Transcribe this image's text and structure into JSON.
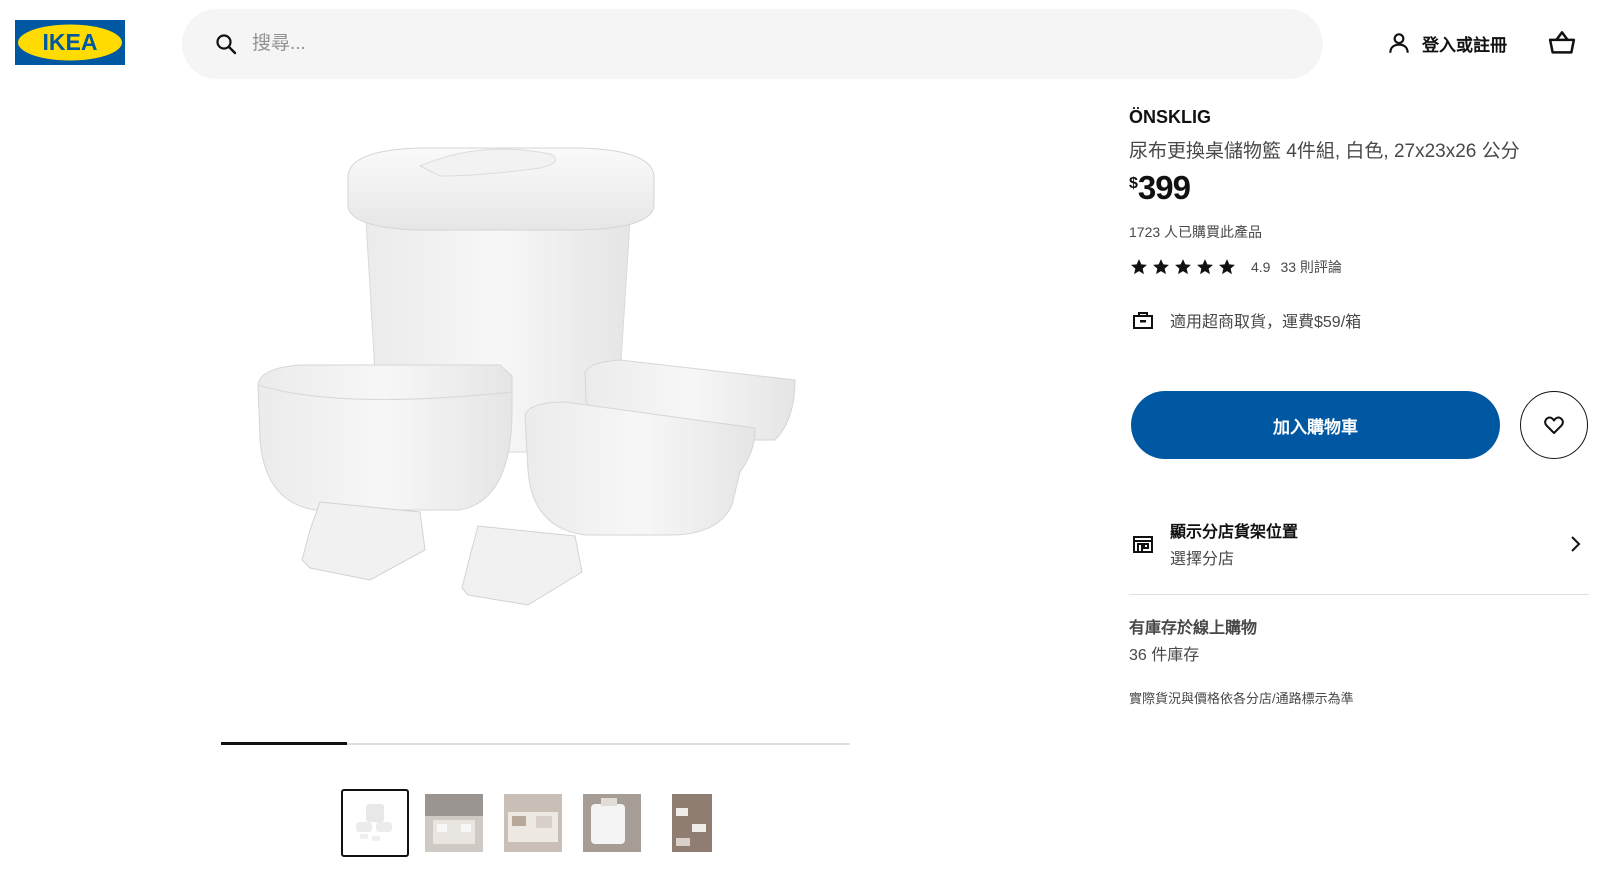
{
  "header": {
    "logo_text": "IKEA",
    "search_placeholder": "搜尋...",
    "login_label": "登入或註冊"
  },
  "gallery": {
    "progress": 0.2,
    "thumbnails": [
      "product-white",
      "room-scene-1",
      "room-scene-2",
      "room-scene-3",
      "room-scene-4"
    ],
    "active_thumbnail": 0
  },
  "product": {
    "name": "ÖNSKLIG",
    "description": "尿布更換桌儲物籃 4件組, 白色, 27x23x26 公分",
    "currency": "$",
    "price": "399",
    "bought": "1723 人已購買此產品",
    "rating_stars": 5,
    "rating_score": "4.9",
    "reviews": "33 則評論",
    "delivery": "適用超商取貨，運費$59/箱"
  },
  "actions": {
    "add_to_cart": "加入購物車"
  },
  "store": {
    "title": "顯示分店貨架位置",
    "subtitle": "選擇分店"
  },
  "stock": {
    "title": "有庫存於線上購物",
    "count": "36 件庫存",
    "disclaimer": "實際貨況與價格依各分店/通路標示為準"
  },
  "colors": {
    "ikea_blue": "#0058a3",
    "ikea_yellow": "#ffdb00",
    "search_bg": "#f5f5f5"
  }
}
